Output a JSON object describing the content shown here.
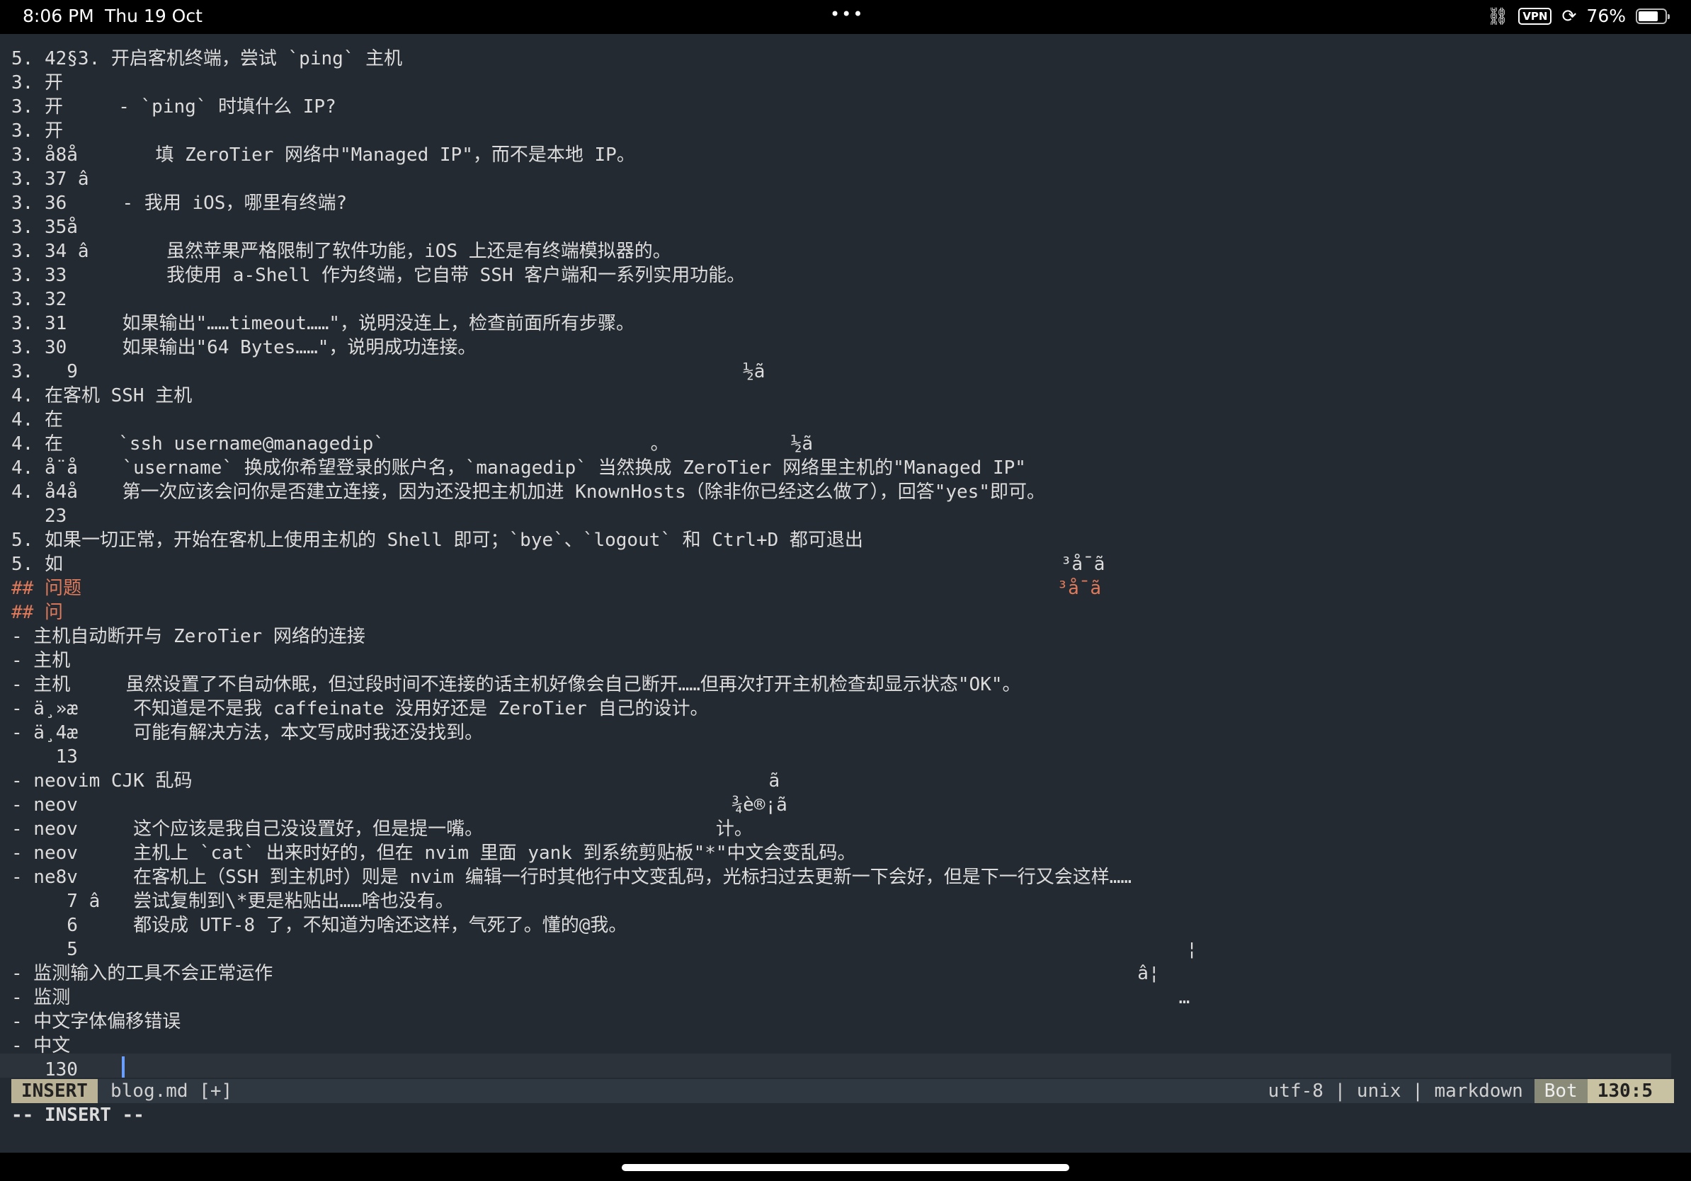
{
  "statusbar": {
    "time": "8:06 PM",
    "date": "Thu 19 Oct",
    "dots": "•••",
    "vpn": "VPN",
    "battery_pct": "76%",
    "battery_level": 0.76
  },
  "editor": {
    "lines": [
      [
        "5. 42§3. 开启客机终端，尝试 `ping` 主机",
        "num"
      ],
      [
        "3. 开",
        "num"
      ],
      [
        "3. 开     - `ping` 时填什么 IP?",
        "num"
      ],
      [
        "3. 开",
        "num"
      ],
      [
        "3. å8å       填 ZeroTier 网络中\"Managed IP\"，而不是本地 IP。",
        "num"
      ],
      [
        "3. 37 â",
        "num"
      ],
      [
        "3. 36     - 我用 iOS，哪里有终端?",
        "num"
      ],
      [
        "3. 35å",
        "num"
      ],
      [
        "3. 34 â       虽然苹果严格限制了软件功能，iOS 上还是有终端模拟器的。",
        "num"
      ],
      [
        "3. 33         我使用 a-Shell 作为终端，它自带 SSH 客户端和一系列实用功能。",
        "num"
      ],
      [
        "3. 32",
        "num"
      ],
      [
        "3. 31     如果输出\"……timeout……\"，说明没连上，检查前面所有步骤。",
        "num"
      ],
      [
        "3. 30     如果输出\"64 Bytes……\"，说明成功连接。",
        "num"
      ],
      [
        "3.   9                                                            ½ã",
        "num"
      ],
      [
        "4. 在客机 SSH 主机",
        "num"
      ],
      [
        "4. 在",
        "num"
      ],
      [
        "4. 在     `ssh username@managedip`                        。           ½ã",
        "num"
      ],
      [
        "4. å¨å    `username` 换成你希望登录的账户名，`managedip` 当然换成 ZeroTier 网络里主机的\"Managed IP\"",
        "num"
      ],
      [
        "4. å4å    第一次应该会问你是否建立连接，因为还没把主机加进 KnownHosts（除非你已经这么做了），回答\"yes\"即可。",
        "num"
      ],
      [
        "   23",
        "num"
      ],
      [
        "5. 如果一切正常，开始在客机上使用主机的 Shell 即可；`bye`、`logout` 和 Ctrl+D 都可退出",
        "num"
      ],
      [
        "5. 如                                                                                          ³å¯ã",
        "num"
      ],
      [
        "## 问题                                                                                        ³å¯ã",
        "hdr"
      ],
      [
        "## 问",
        "hdr"
      ],
      [
        "- 主机自动断开与 ZeroTier 网络的连接",
        "plain"
      ],
      [
        "- 主机",
        "plain"
      ],
      [
        "- 主机     虽然设置了不自动休眠，但过段时间不连接的话主机好像会自己断开……但再次打开主机检查却显示状态\"OK\"。",
        "plain"
      ],
      [
        "- ä¸»æ     不知道是不是我 caffeinate 没用好还是 ZeroTier 自己的设计。",
        "plain"
      ],
      [
        "- ä¸4æ     可能有解决方法，本文写成时我还没找到。",
        "plain"
      ],
      [
        "    13",
        "num"
      ],
      [
        "- neovim CJK 乱码                                                    ã",
        "plain"
      ],
      [
        "- neov                                                           ¾è®¡ã",
        "plain"
      ],
      [
        "- neov     这个应该是我自己没设置好，但是提一嘴。                     计。",
        "plain"
      ],
      [
        "- neov     主机上 `cat` 出来时好的，但在 nvim 里面 yank 到系统剪贴板\"*\"中文会变乱码。",
        "plain"
      ],
      [
        "- ne8v     在客机上（SSH 到主机时）则是 nvim 编辑一行时其他行中文变乱码，光标扫过去更新一下会好，但是下一行又会这样……",
        "plain"
      ],
      [
        "     7 â   尝试复制到\\*更是粘贴出……啥也没有。",
        "plain"
      ],
      [
        "     6     都设成 UTF-8 了，不知道为啥还这样，气死了。懂的@我。",
        "plain"
      ],
      [
        "     5                                                                                                    ¦",
        "plain"
      ],
      [
        "- 监测输入的工具不会正常运作                                                                              â¦",
        "plain"
      ],
      [
        "- 监测                                                                                                    …",
        "plain"
      ],
      [
        "- 中文字体偏移错误",
        "plain"
      ],
      [
        "- 中文",
        "plain"
      ],
      [
        "   130",
        "num"
      ]
    ]
  },
  "statusline": {
    "mode": "INSERT",
    "file": "blog.md [+]",
    "encoding": "utf-8",
    "sep1": "|",
    "format": "unix",
    "sep2": "|",
    "filetype": "markdown",
    "position": "Bot",
    "linecol": "130:5"
  },
  "cmdline": "-- INSERT --"
}
